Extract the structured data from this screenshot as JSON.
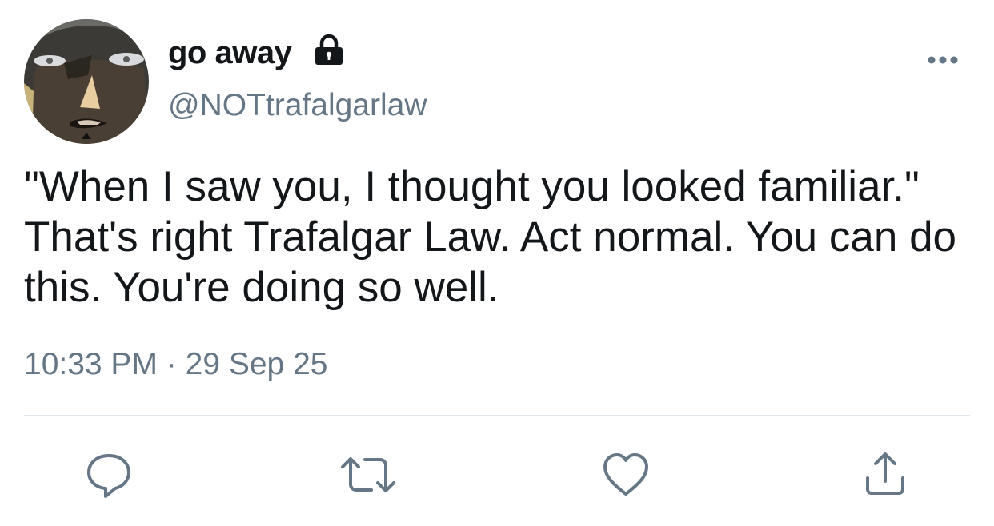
{
  "user": {
    "display_name": "go away",
    "handle": "@NOTtrafalgarlaw",
    "protected_icon": "lock-icon",
    "avatar": "avatar-image"
  },
  "tweet": {
    "text": "\"When I saw you, I thought you looked familiar.\" That's right Trafalgar Law. Act normal. You can do this. You're doing so well.",
    "time": "10:33 PM",
    "separator": "·",
    "date": "29 Sep 25"
  },
  "actions": {
    "more": "more-icon",
    "reply": "reply-icon",
    "retweet": "retweet-icon",
    "like": "heart-icon",
    "share": "share-icon"
  },
  "colors": {
    "text": "#14171a",
    "secondary": "#657786",
    "divider": "#e1e8ed",
    "icon": "#657786"
  }
}
